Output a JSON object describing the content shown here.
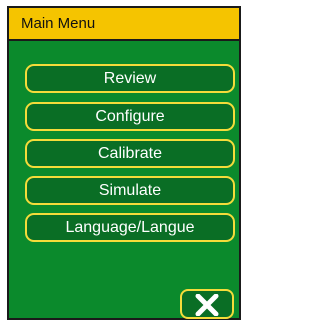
{
  "header": {
    "title": "Main Menu"
  },
  "menu": {
    "items": [
      {
        "label": "Review"
      },
      {
        "label": "Configure"
      },
      {
        "label": "Calibrate"
      },
      {
        "label": "Simulate"
      },
      {
        "label": "Language/Langue"
      }
    ]
  },
  "footer": {
    "close_icon": "close-icon"
  },
  "colors": {
    "background": "#0b8a2c",
    "button_fill": "#0a6e25",
    "button_border": "#f5dc3a",
    "title_bar": "#f5c400",
    "text": "#ffffff"
  }
}
